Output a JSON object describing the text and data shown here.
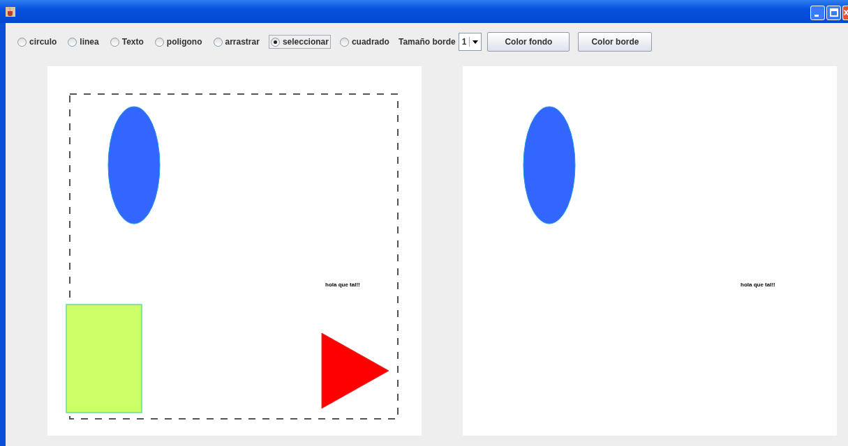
{
  "toolbar": {
    "modes": [
      {
        "label": "circulo",
        "selected": false
      },
      {
        "label": "linea",
        "selected": false
      },
      {
        "label": "Texto",
        "selected": false
      },
      {
        "label": "poligono",
        "selected": false
      },
      {
        "label": "arrastrar",
        "selected": false
      },
      {
        "label": "seleccionar",
        "selected": true
      },
      {
        "label": "cuadrado",
        "selected": false
      }
    ],
    "border_size": {
      "label": "Tamaño borde",
      "value": "1"
    },
    "buttons": [
      "Color fondo",
      "Color borde"
    ]
  },
  "canvases": [
    {
      "shapes": [
        {
          "kind": "selection"
        },
        {
          "kind": "ellipse",
          "color": "#3366ff"
        },
        {
          "kind": "text",
          "text": "hola que tal!!"
        },
        {
          "kind": "rectangle",
          "color": "#ccff66"
        },
        {
          "kind": "triangle",
          "color": "#ff0000"
        }
      ]
    },
    {
      "shapes": [
        {
          "kind": "ellipse",
          "color": "#3366ff"
        },
        {
          "kind": "text",
          "text": "hola que tal!!"
        }
      ]
    }
  ]
}
